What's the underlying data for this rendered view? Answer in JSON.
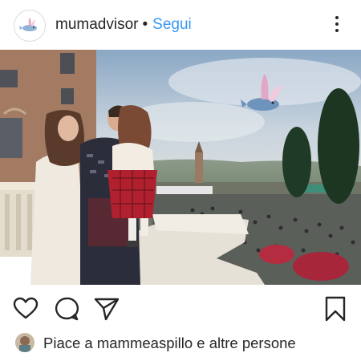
{
  "post": {
    "username": "mumadvisor",
    "separator": "•",
    "follow_label": "Segui"
  },
  "icons": {
    "more": "more-vertical-icon",
    "like": "heart-icon",
    "comment": "comment-icon",
    "share": "paper-plane-icon",
    "save": "bookmark-icon"
  },
  "likes": {
    "prefix": "Piace a",
    "user": "mammeaspillo",
    "conjunction": "e",
    "others": "altre persone"
  },
  "colors": {
    "link_blue": "#3897f0",
    "text": "#262626"
  }
}
